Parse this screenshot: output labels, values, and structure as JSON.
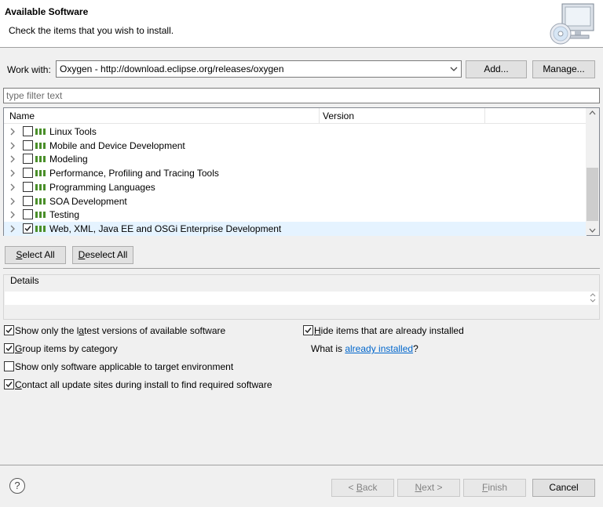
{
  "header": {
    "title": "Available Software",
    "subtitle": "Check the items that you wish to install."
  },
  "work_with": {
    "label": "Work with:",
    "value": "Oxygen - http://download.eclipse.org/releases/oxygen",
    "add_label": "Add...",
    "manage_label": "Manage..."
  },
  "filter": {
    "placeholder": "type filter text"
  },
  "tree": {
    "columns": [
      "Name",
      "Version"
    ],
    "items": [
      {
        "label": "Linux Tools",
        "checked": false
      },
      {
        "label": "Mobile and Device Development",
        "checked": false
      },
      {
        "label": "Modeling",
        "checked": false
      },
      {
        "label": "Performance, Profiling and Tracing Tools",
        "checked": false
      },
      {
        "label": "Programming Languages",
        "checked": false
      },
      {
        "label": "SOA Development",
        "checked": false
      },
      {
        "label": "Testing",
        "checked": false
      },
      {
        "label": "Web, XML, Java EE and OSGi Enterprise Development",
        "checked": true
      }
    ]
  },
  "selection": {
    "select_all": "Select All",
    "deselect_all": "Deselect All"
  },
  "details": {
    "legend": "Details"
  },
  "options": {
    "latest_versions": {
      "label": "Show only the latest versions of available software",
      "checked": true
    },
    "group_by_category": {
      "label": "Group items by category",
      "checked": true
    },
    "target_env": {
      "label": "Show only software applicable to target environment",
      "checked": false
    },
    "contact_sites": {
      "label": "Contact all update sites during install to find required software",
      "checked": true
    },
    "hide_installed": {
      "label": "Hide items that are already installed",
      "checked": true
    },
    "what_is_prefix": "What is ",
    "already_installed_link": "already installed",
    "what_is_suffix": "?"
  },
  "footer": {
    "help_glyph": "?",
    "back": "< Back",
    "next": "Next >",
    "finish": "Finish",
    "cancel": "Cancel"
  },
  "colors": {
    "selected_row": "#e5f3ff",
    "link": "#0066cc",
    "package_icon": "#4a8f2a"
  }
}
